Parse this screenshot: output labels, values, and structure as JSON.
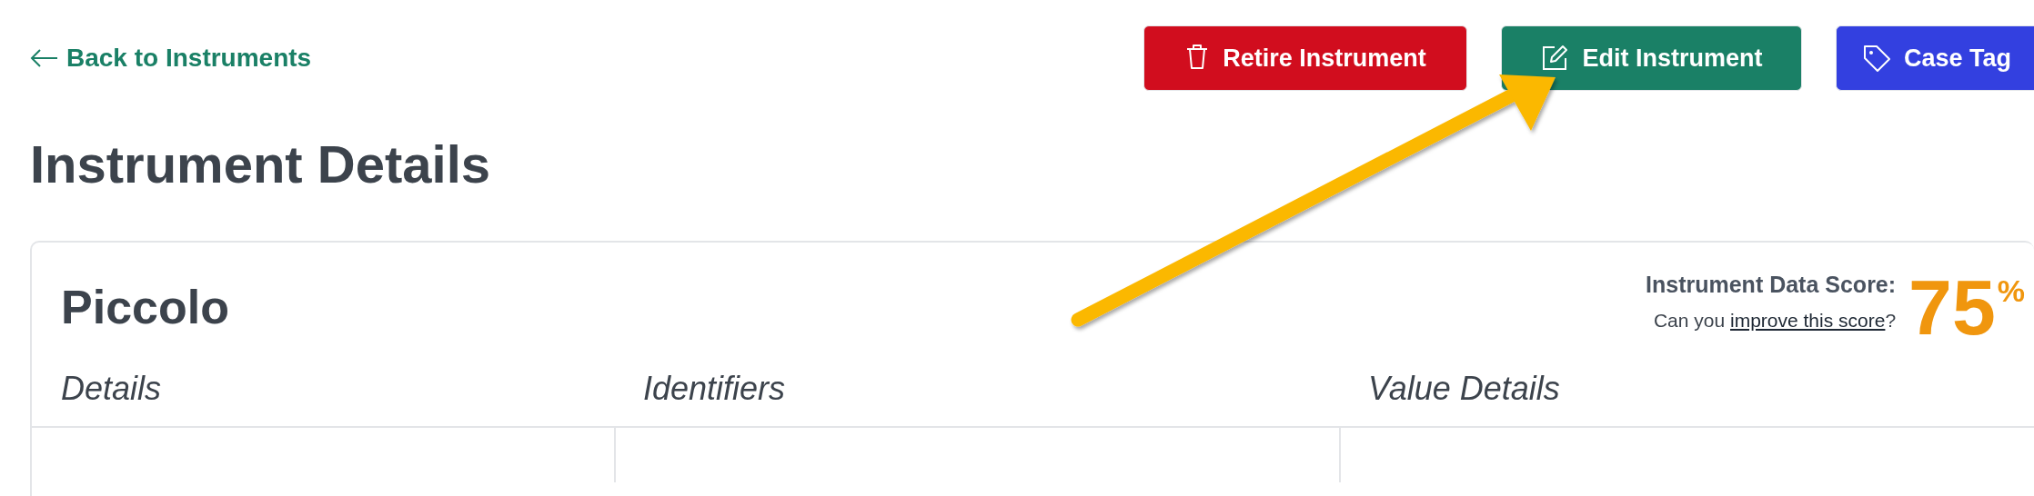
{
  "back_link": {
    "label": "Back to Instruments"
  },
  "actions": [
    {
      "kind": "retire",
      "label": "Retire Instrument"
    },
    {
      "kind": "edit",
      "label": "Edit Instrument"
    },
    {
      "kind": "tag",
      "label": "Case Tag"
    }
  ],
  "page_title": "Instrument Details",
  "card": {
    "title": "Piccolo",
    "score": {
      "label": "Instrument Data Score:",
      "prompt": "Can you",
      "link": "improve this score",
      "suffix": "?",
      "value": "75",
      "unit": "%"
    },
    "columns": [
      "Details",
      "Identifiers",
      "Value Details"
    ]
  },
  "annotation": {
    "kind": "arrow"
  }
}
